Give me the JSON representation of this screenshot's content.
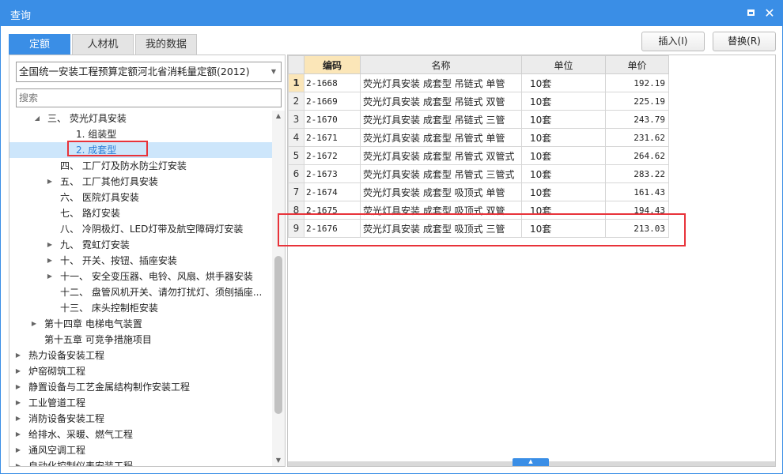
{
  "window": {
    "title": "查询"
  },
  "tabs": [
    {
      "label": "定额",
      "active": true
    },
    {
      "label": "人材机",
      "active": false
    },
    {
      "label": "我的数据",
      "active": false
    }
  ],
  "buttons": {
    "insert": "插入(I)",
    "replace": "替换(R)"
  },
  "library_select": {
    "value": "全国统一安装工程预算定额河北省消耗量定额(2012)"
  },
  "search": {
    "placeholder": "搜索",
    "value": ""
  },
  "tree": [
    {
      "label": "三、 荧光灯具安装",
      "expanded": true
    },
    {
      "label": "1. 组装型"
    },
    {
      "label": "2. 成套型",
      "selected": true
    },
    {
      "label": "四、 工厂灯及防水防尘灯安装"
    },
    {
      "label": "五、 工厂其他灯具安装",
      "collapsed": true
    },
    {
      "label": "六、 医院灯具安装"
    },
    {
      "label": "七、 路灯安装"
    },
    {
      "label": "八、 冷阴极灯、LED灯带及航空障碍灯安装"
    },
    {
      "label": "九、 霓虹灯安装",
      "collapsed": true
    },
    {
      "label": "十、 开关、按钮、插座安装",
      "collapsed": true
    },
    {
      "label": "十一、 安全变压器、电铃、风扇、烘手器安装",
      "collapsed": true
    },
    {
      "label": "十二、 盘管风机开关、请勿打扰灯、须刨插座..."
    },
    {
      "label": "十三、 床头控制柜安装"
    },
    {
      "label": "第十四章 电梯电气装置",
      "collapsed": true
    },
    {
      "label": "第十五章 可竞争措施项目"
    },
    {
      "label": "热力设备安装工程",
      "collapsed": true
    },
    {
      "label": "炉窑砌筑工程",
      "collapsed": true
    },
    {
      "label": "静置设备与工艺金属结构制作安装工程",
      "collapsed": true
    },
    {
      "label": "工业管道工程",
      "collapsed": true
    },
    {
      "label": "消防设备安装工程",
      "collapsed": true
    },
    {
      "label": "给排水、采暖、燃气工程",
      "collapsed": true
    },
    {
      "label": "通风空调工程",
      "collapsed": true
    },
    {
      "label": "自动化控制仪表安装工程",
      "collapsed": true
    }
  ],
  "grid": {
    "columns": {
      "code": "编码",
      "name": "名称",
      "unit": "单位",
      "price": "单价"
    },
    "rows": [
      {
        "num": "1",
        "code": "2-1668",
        "name": "荧光灯具安装 成套型 吊链式 单管",
        "unit": "10套",
        "price": "192.19"
      },
      {
        "num": "2",
        "code": "2-1669",
        "name": "荧光灯具安装 成套型 吊链式 双管",
        "unit": "10套",
        "price": "225.19"
      },
      {
        "num": "3",
        "code": "2-1670",
        "name": "荧光灯具安装 成套型 吊链式 三管",
        "unit": "10套",
        "price": "243.79"
      },
      {
        "num": "4",
        "code": "2-1671",
        "name": "荧光灯具安装 成套型 吊管式 单管",
        "unit": "10套",
        "price": "231.62"
      },
      {
        "num": "5",
        "code": "2-1672",
        "name": "荧光灯具安装 成套型 吊管式 双管式",
        "unit": "10套",
        "price": "264.62"
      },
      {
        "num": "6",
        "code": "2-1673",
        "name": "荧光灯具安装 成套型 吊管式 三管式",
        "unit": "10套",
        "price": "283.22"
      },
      {
        "num": "7",
        "code": "2-1674",
        "name": "荧光灯具安装 成套型 吸顶式 单管",
        "unit": "10套",
        "price": "161.43"
      },
      {
        "num": "8",
        "code": "2-1675",
        "name": "荧光灯具安装 成套型 吸顶式 双管",
        "unit": "10套",
        "price": "194.43"
      },
      {
        "num": "9",
        "code": "2-1676",
        "name": "荧光灯具安装 成套型 吸顶式 三管",
        "unit": "10套",
        "price": "213.03"
      }
    ]
  }
}
